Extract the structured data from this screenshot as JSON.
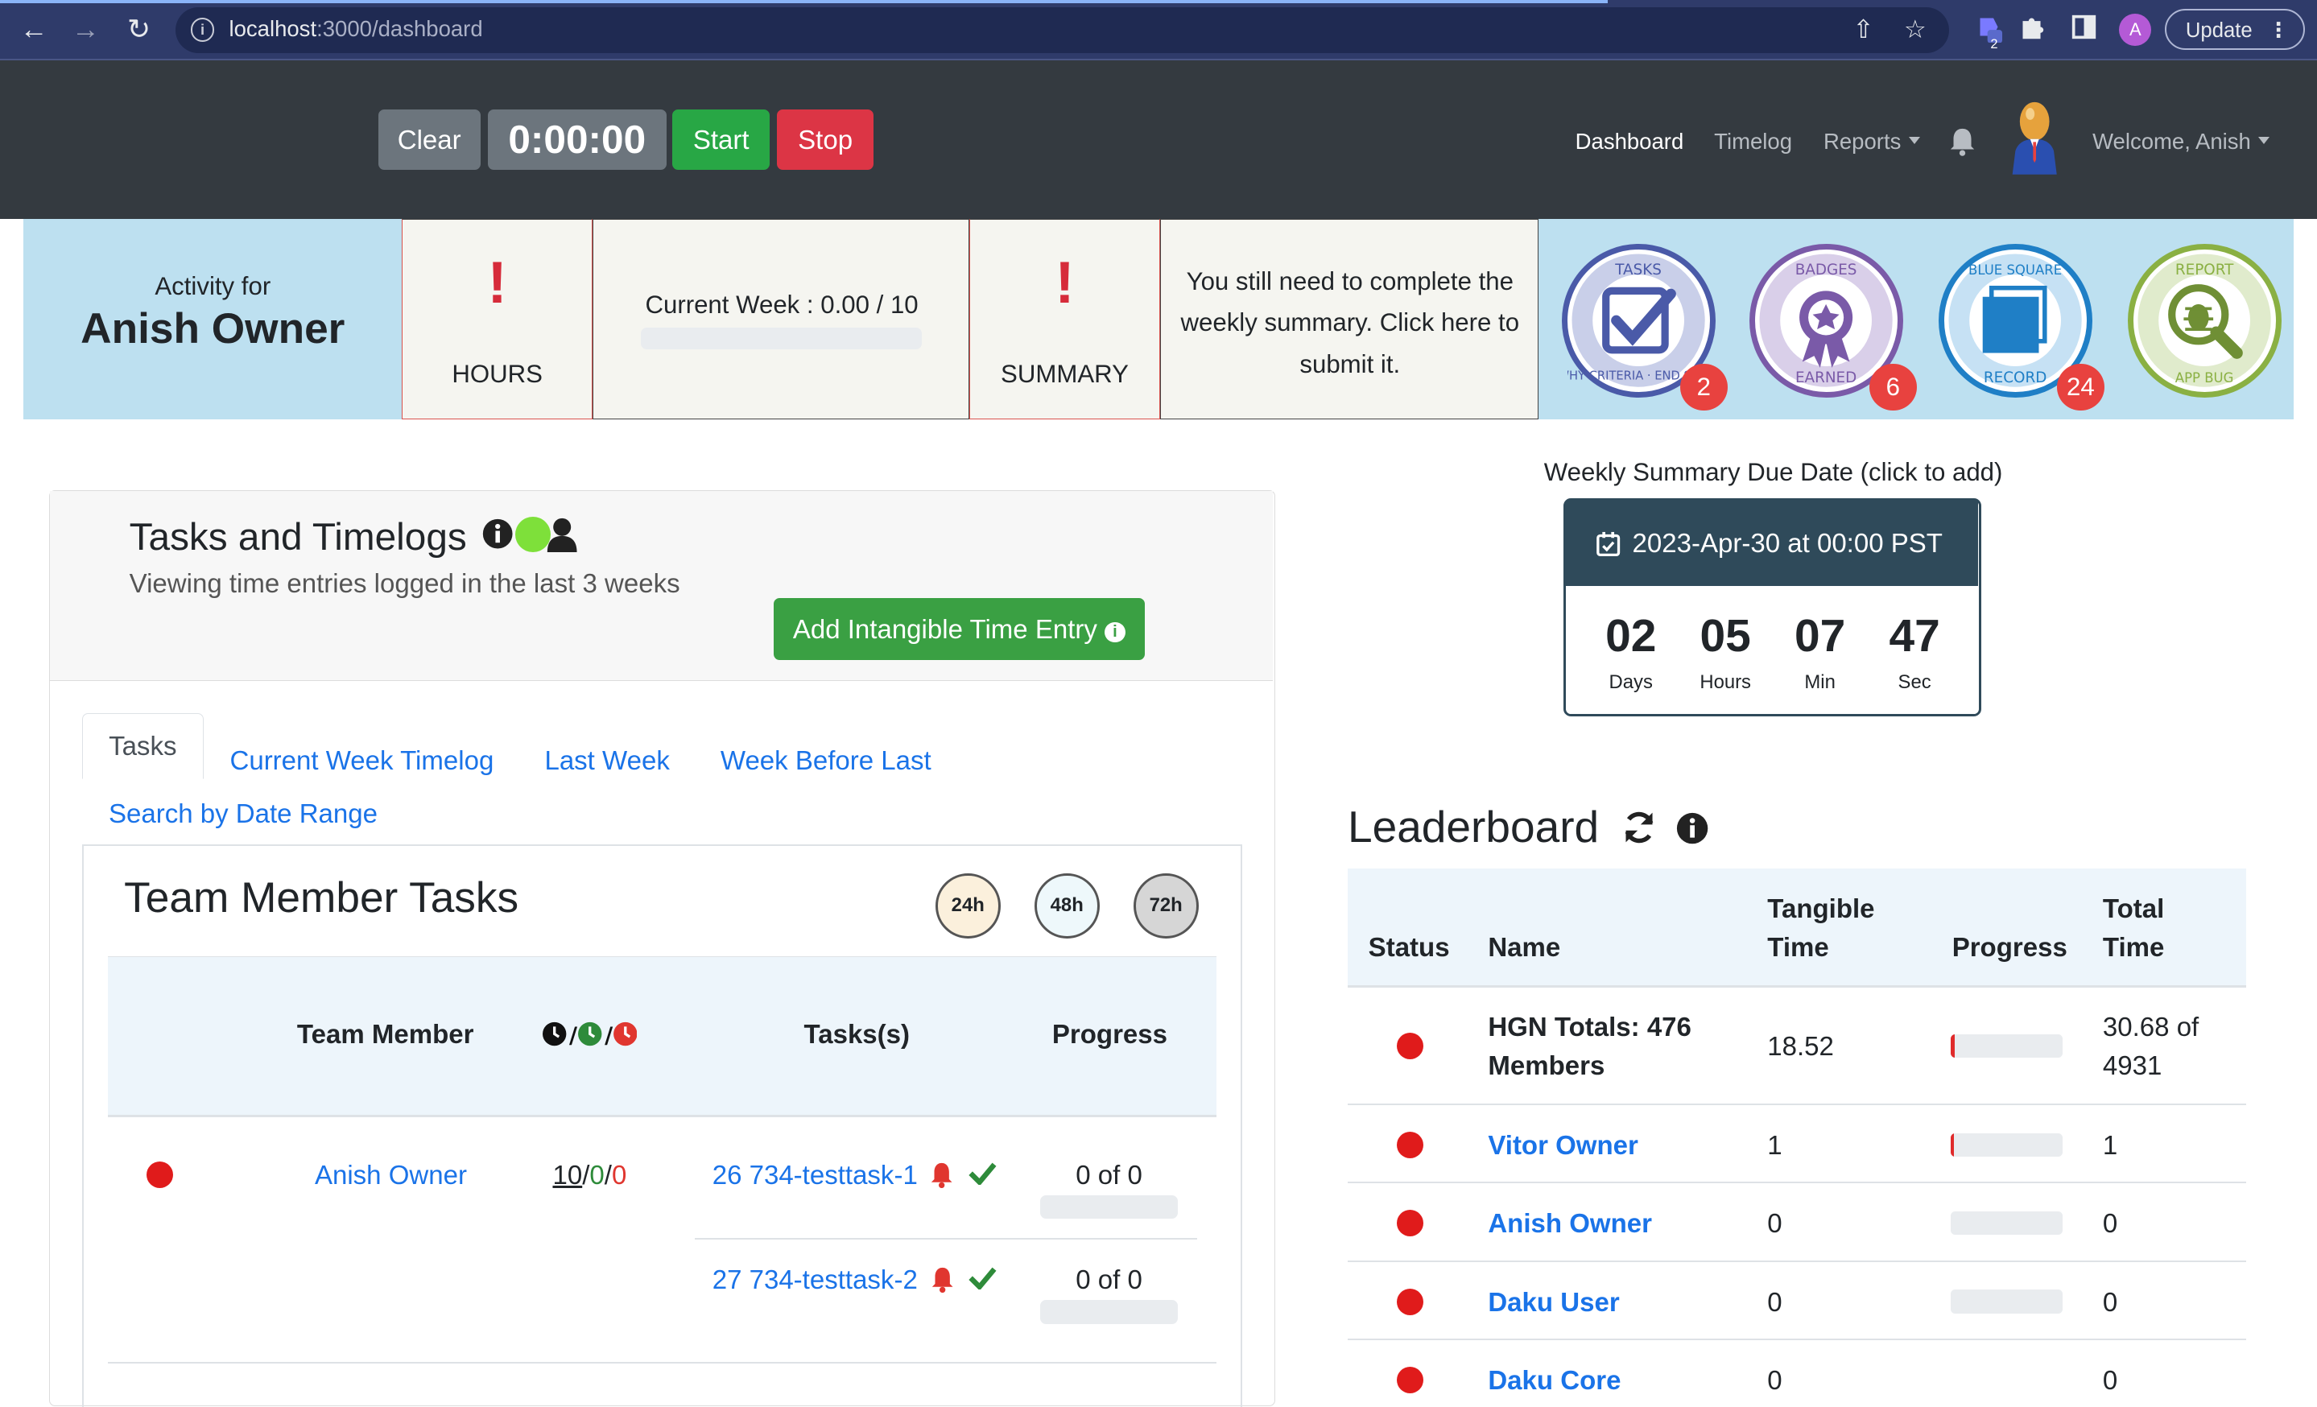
{
  "browser": {
    "url_host": "localhost",
    "url_path": ":3000/dashboard",
    "extension_badge": "2",
    "profile_initial": "A",
    "update_label": "Update"
  },
  "navbar": {
    "clear_label": "Clear",
    "timer": "0:00:00",
    "start_label": "Start",
    "stop_label": "Stop",
    "links": {
      "dashboard": "Dashboard",
      "timelog": "Timelog",
      "reports": "Reports",
      "welcome": "Welcome, Anish"
    }
  },
  "activity": {
    "activity_for": "Activity for",
    "name": "Anish Owner",
    "hours_alert": "!",
    "hours_label": "HOURS",
    "current_week": "Current Week : 0.00 / 10",
    "current_week_progress": 0,
    "summary_alert": "!",
    "summary_label": "SUMMARY",
    "summary_message": "You still need to complete the weekly summary. Click here to submit it."
  },
  "badges": [
    {
      "name": "tasks-badge",
      "ring_text_top": "TASKS",
      "ring_text_bottom": "WHY CRITERIA · END STATE",
      "count": "2",
      "color": "#4a5aa8"
    },
    {
      "name": "badges-earned-badge",
      "ring_text_top": "BADGES",
      "ring_text_bottom": "EARNED",
      "count": "6",
      "color": "#7a5aa8"
    },
    {
      "name": "blue-square-badge",
      "ring_text_top": "BLUE SQUARE",
      "ring_text_bottom": "RECORD",
      "count": "24",
      "color": "#1f7fc6"
    },
    {
      "name": "report-bug-badge",
      "ring_text_top": "REPORT",
      "ring_text_bottom": "APP BUG",
      "count": "",
      "color": "#8ab043"
    }
  ],
  "tasks_card": {
    "title": "Tasks and Timelogs",
    "subtitle": "Viewing time entries logged in the last 3 weeks",
    "add_entry_label": "Add Intangible Time Entry",
    "tabs": [
      "Tasks",
      "Current Week Timelog",
      "Last Week",
      "Week Before Last",
      "Search by Date Range"
    ],
    "team_title": "Team Member Tasks",
    "hour_filters": [
      "24h",
      "48h",
      "72h"
    ],
    "columns": {
      "member": "Team Member",
      "tasks": "Tasks(s)",
      "progress": "Progress"
    },
    "rows": [
      {
        "member": "Anish Owner",
        "hours": [
          "10",
          "0",
          "0"
        ],
        "tasks": [
          {
            "label": "26 734-testtask-1",
            "progress": "0 of 0"
          },
          {
            "label": "27 734-testtask-2",
            "progress": "0 of 0"
          }
        ]
      }
    ]
  },
  "due_date": {
    "caption": "Weekly Summary Due Date (click to add)",
    "date": "2023-Apr-30 at 00:00 PST",
    "countdown": [
      {
        "value": "02",
        "unit": "Days"
      },
      {
        "value": "05",
        "unit": "Hours"
      },
      {
        "value": "07",
        "unit": "Min"
      },
      {
        "value": "47",
        "unit": "Sec"
      }
    ]
  },
  "leaderboard": {
    "title": "Leaderboard",
    "columns": {
      "status": "Status",
      "name": "Name",
      "tangible_1": "Tangible",
      "tangible_2": "Time",
      "progress": "Progress",
      "total_1": "Total",
      "total_2": "Time"
    },
    "rows": [
      {
        "name_1": "HGN Totals: 476",
        "name_2": "Members",
        "tangible": "18.52",
        "progress": 0.04,
        "total_1": "30.68 of",
        "total_2": "4931"
      },
      {
        "name": "Vitor Owner",
        "tangible": "1",
        "progress": 0.03,
        "total": "1"
      },
      {
        "name": "Anish Owner",
        "tangible": "0",
        "progress": 0,
        "total": "0"
      },
      {
        "name": "Daku User",
        "tangible": "0",
        "progress": 0,
        "total": "0"
      },
      {
        "name": "Daku Core",
        "tangible": "0",
        "progress": 0,
        "total": "0"
      }
    ]
  },
  "colors": {
    "navbar": "#343a40",
    "accent_link": "#1a73e8",
    "success": "#28a745",
    "danger": "#dc3545",
    "status_red": "#e01b1b",
    "strip_blue": "#bde0f0"
  }
}
